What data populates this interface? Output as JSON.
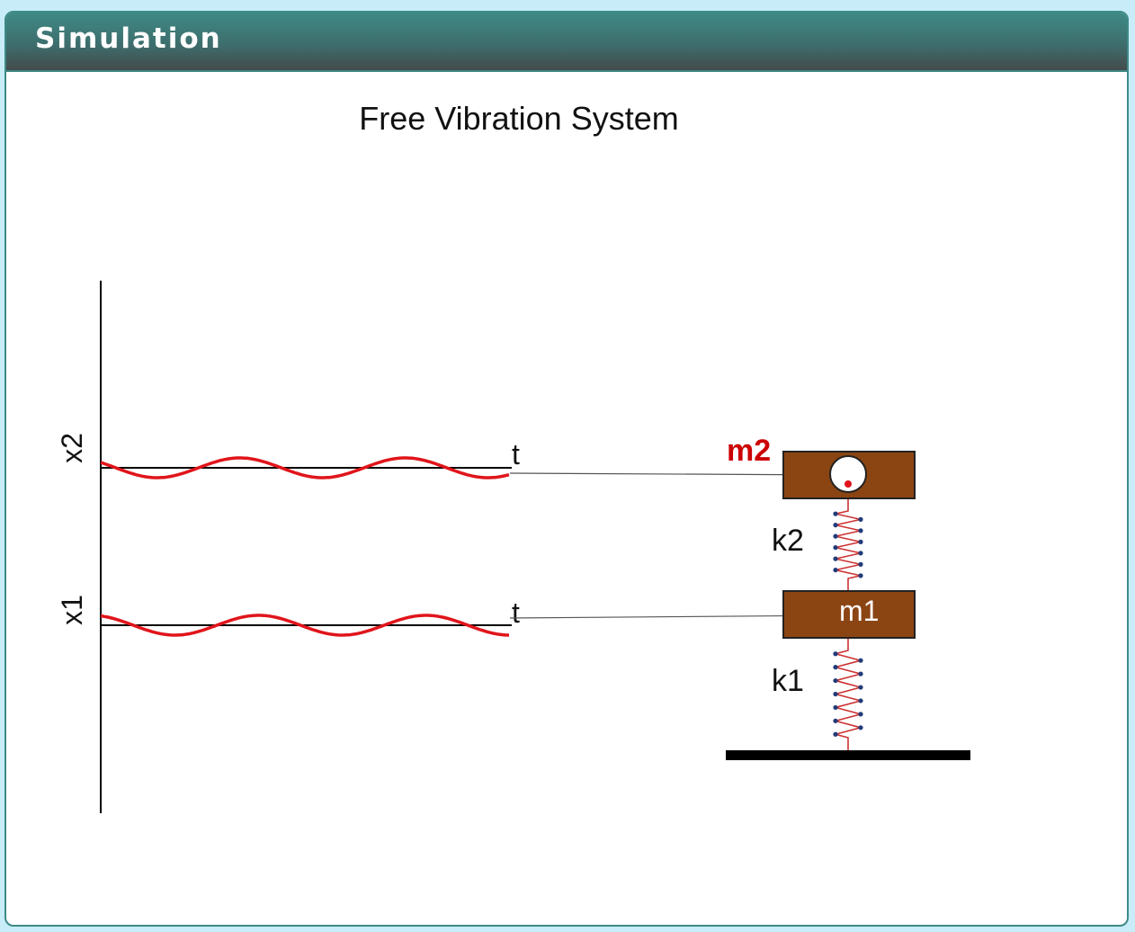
{
  "panel": {
    "title": "Simulation"
  },
  "diagram": {
    "title": "Free Vibration System",
    "axis_x2": "x2",
    "axis_x1": "x1",
    "time_label_top": "t",
    "time_label_bottom": "t",
    "mass2_label": "m2",
    "mass1_label": "m1",
    "spring2_label": "k2",
    "spring1_label": "k1"
  },
  "colors": {
    "header_accent": "#3d8a86",
    "mass_fill": "#8b4513",
    "wave": "#e0151b",
    "mass2_label": "#cc0000",
    "spring_coil": "#cc3333",
    "spring_node": "#223c7a"
  }
}
